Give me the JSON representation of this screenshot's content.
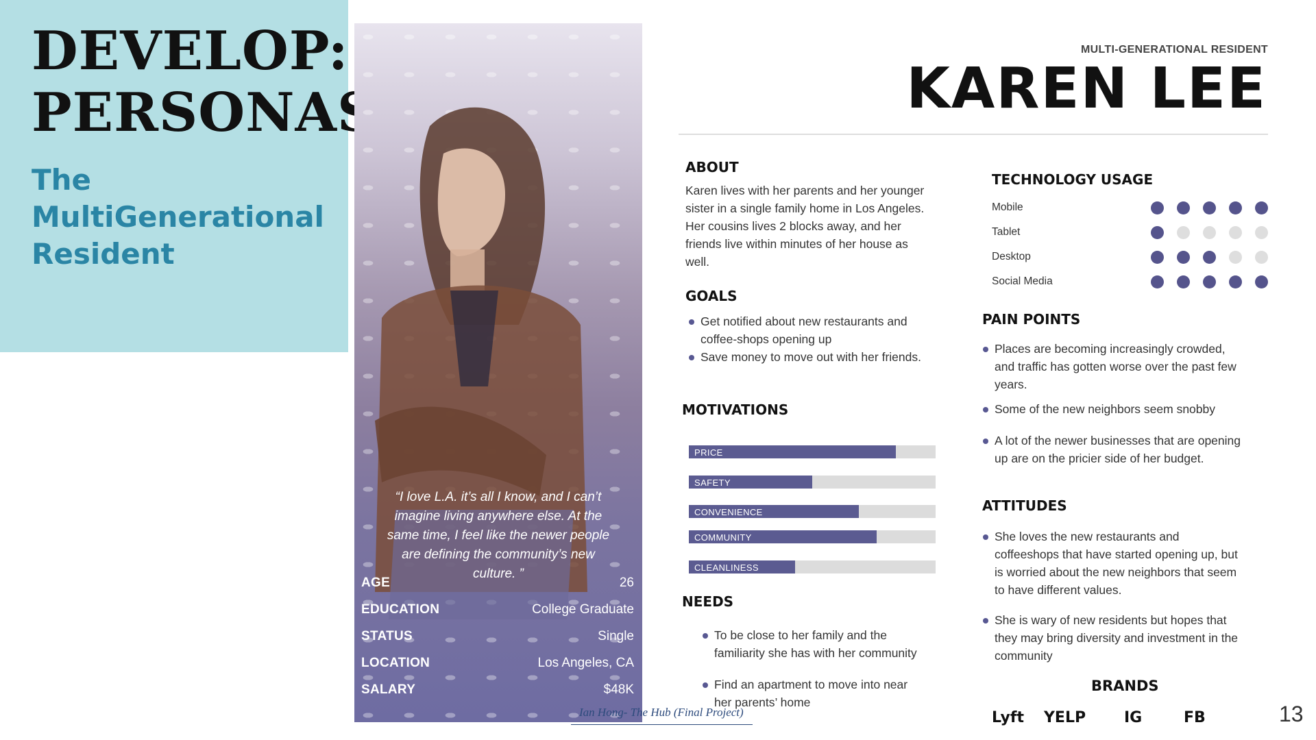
{
  "title": {
    "line1": "DEVELOP:",
    "line2": "PERSONAS"
  },
  "subtitle": {
    "line1": "The",
    "line2": "MultiGenerational",
    "line3": "Resident"
  },
  "persona": {
    "role": "MULTI-GENERATIONAL RESIDENT",
    "name": "KAREN LEE",
    "quote_lines": [
      "“I love L.A. it’s all I know, and I can’t",
      "imagine living anywhere else. At the",
      "same time, I feel like the newer people",
      "are defining the community’s new",
      "culture. ”"
    ],
    "stats": [
      {
        "label": "AGE",
        "value": "26"
      },
      {
        "label": "EDUCATION",
        "value": "College Graduate"
      },
      {
        "label": "STATUS",
        "value": "Single"
      },
      {
        "label": "LOCATION",
        "value": "Los Angeles, CA"
      },
      {
        "label": "SALARY",
        "value": "$48K"
      }
    ]
  },
  "about": {
    "heading": "ABOUT",
    "lines": [
      "Karen lives with her parents and her younger",
      "sister in a single family home in Los Angeles.",
      "Her cousins lives 2 blocks away, and her",
      "friends live within minutes of her house as",
      "well."
    ]
  },
  "goals": {
    "heading": "GOALS",
    "items": [
      [
        "Get notified about new restaurants and",
        "coffee-shops opening up"
      ],
      [
        "Save money to move out with her friends."
      ]
    ]
  },
  "motivations": {
    "heading": "MOTIVATIONS",
    "bars": [
      {
        "label": "PRICE",
        "level": 0.84
      },
      {
        "label": "SAFETY",
        "level": 0.5
      },
      {
        "label": "CONVENIENCE",
        "level": 0.69
      },
      {
        "label": "COMMUNITY",
        "level": 0.76
      },
      {
        "label": "CLEANLINESS",
        "level": 0.43
      }
    ],
    "bar_color": "#5b5b91"
  },
  "needs": {
    "heading": "NEEDS",
    "items": [
      [
        "To be close to her family and the",
        "familiarity she has with her community"
      ],
      [
        "Find an apartment to move into near",
        "her parents’ home"
      ]
    ]
  },
  "technology": {
    "heading": "TECHNOLOGY USAGE",
    "rows": [
      {
        "label": "Mobile",
        "level": 5
      },
      {
        "label": "Tablet",
        "level": 1
      },
      {
        "label": "Desktop",
        "level": 3
      },
      {
        "label": "Social Media",
        "level": 5
      }
    ],
    "max": 5,
    "dot_on_color": "#55548c"
  },
  "pain_points": {
    "heading": "PAIN POINTS",
    "items": [
      [
        "Places are becoming increasingly crowded,",
        "and traffic has gotten worse over the past few",
        "years."
      ],
      [
        "Some of the new neighbors seem snobby"
      ],
      [
        "A lot of the newer businesses that are opening",
        "up are on the pricier side of her budget."
      ]
    ]
  },
  "attitudes": {
    "heading": "ATTITUDES",
    "items": [
      [
        "She loves the new restaurants and",
        "coffeeshops that have started opening up, but",
        "is worried about the new neighbors that seem",
        "to have different values."
      ],
      [
        "She is wary of new residents but hopes that",
        "they may bring diversity and investment in the",
        "community"
      ]
    ]
  },
  "brands": {
    "heading": "BRANDS",
    "items": [
      "Lyft",
      "YELP",
      "IG",
      "FB"
    ]
  },
  "footer": {
    "text": "Ian Hong- The Hub (Final Project)"
  },
  "page_number": "13"
}
